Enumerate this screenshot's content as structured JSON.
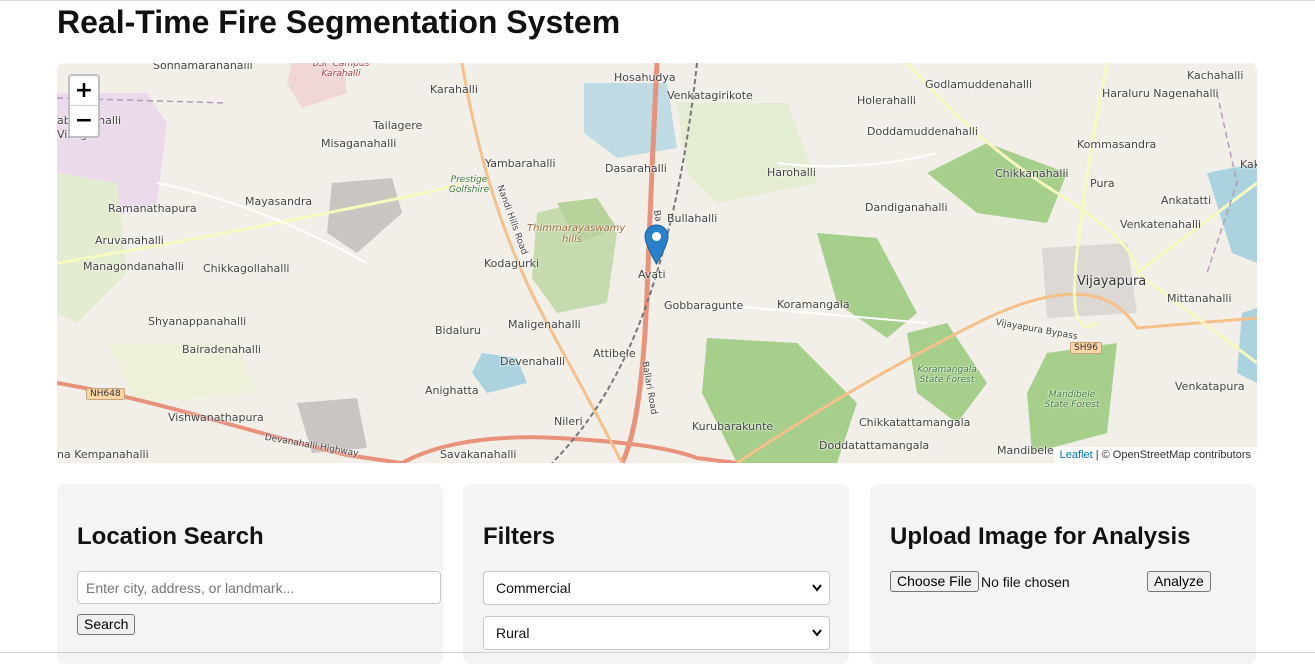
{
  "page": {
    "title": "Real-Time Fire Segmentation System"
  },
  "map": {
    "zoom_in": "+",
    "zoom_out": "−",
    "attribution_link": "Leaflet",
    "attribution_text": "| © OpenStreetMap contributors",
    "labels": {
      "sonnamaranahalli": "Sonnamaranahalli",
      "bsf_campus": "BSF Campus Karahalli",
      "karahalli": "Karahalli",
      "hosahudya": "Hosahudya",
      "venkatagirikote": "Venkatagirikote",
      "godlamuddenahalli": "Godlamuddenahalli",
      "kachahalli": "Kachahalli",
      "holerahalli": "Holerahalli",
      "haraluru_nagenahalli": "Haraluru Nagenahalli",
      "abbanahalli_village": "abbanahalli Village",
      "tailagere": "Tailagere",
      "misaganahalli": "Misaganahalli",
      "doddamuddenahalli": "Doddamuddenahalli",
      "kommasandra": "Kommasandra",
      "yambarahalli": "Yambarahalli",
      "dasarahalli": "Dasarahalli",
      "kak": "Kak",
      "prestige_golfshire": "Prestige Golfshire",
      "harohalli": "Harohalli",
      "chikkanahalli": "Chikkanahalli",
      "pura": "Pura",
      "ramanathapura": "Ramanathapura",
      "mayasandra": "Mayasandra",
      "nandi_hills_road": "Nandi Hills Road",
      "ankatatti": "Ankatatti",
      "bullahalli": "Bullahalli",
      "dandiganahalli": "Dandiganahalli",
      "thimmarayaswamy_hills": "Thimmarayaswamy hills",
      "aruvanahalli": "Aruvanahalli",
      "venkatenahalli": "Venkatenahalli",
      "managondanahalli": "Managondanahalli",
      "chikkagollahalli": "Chikkagollahalli",
      "kodagurki": "Kodagurki",
      "avati": "Avati",
      "vijayapura": "Vijayapura",
      "gobbaragunte": "Gobbaragunte",
      "koramangala": "Koramangala",
      "mittanahalli": "Mittanahalli",
      "shyanappanahalli": "Shyanappanahalli",
      "bidaluru": "Bidaluru",
      "maligenahalli": "Maligenahalli",
      "vijayapura_bypass": "Vijayapura Bypass",
      "bairadenahalli": "Bairadenahalli",
      "attibele": "Attibele",
      "sh96": "SH96",
      "devenahalli": "Devenahalli",
      "koramangala_forest": "Koramangala State Forest",
      "venkatapura": "Venkatapura",
      "nh648": "NH648",
      "anighatta": "Anighatta",
      "ballari_road": "Ballari Road",
      "mandibele_forest": "Mandibele State Forest",
      "vishwanathapura": "Vishwanathapura",
      "nileri": "Nileri",
      "kurubarakunte": "Kurubarakunte",
      "chikkatattamangala": "Chikkatattamangala",
      "devanahalli_highway": "Devanahalli Highway",
      "doddatattamangala": "Doddatattamangala",
      "mandibele": "Mandibele",
      "kempanahalli": "na Kempanahalli",
      "savakanahalli": "Savakanahalli",
      "ballari_road_north": "Ba"
    }
  },
  "location_search": {
    "title": "Location Search",
    "placeholder": "Enter city, address, or landmark...",
    "button": "Search"
  },
  "filters": {
    "title": "Filters",
    "selects": [
      "Commercial",
      "Rural"
    ]
  },
  "upload": {
    "title": "Upload Image for Analysis",
    "choose_button": "Choose File",
    "file_status": "No file chosen",
    "analyze_button": "Analyze"
  }
}
